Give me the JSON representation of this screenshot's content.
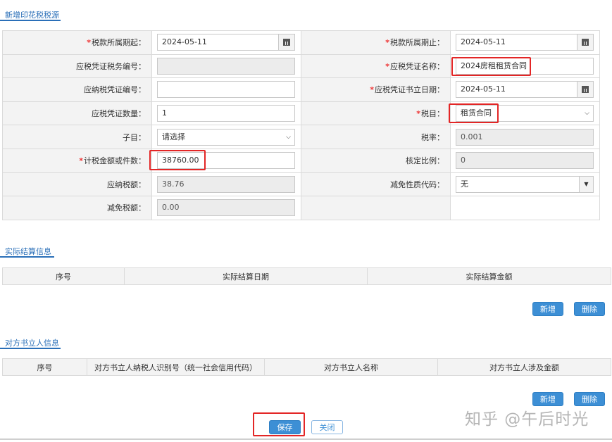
{
  "section1": {
    "title": "新增印花税税源"
  },
  "form": {
    "period_start_label": "税款所属期起：",
    "period_start_value": "2024-05-11",
    "period_end_label": "税款所属期止：",
    "period_end_value": "2024-05-11",
    "voucher_tax_no_label": "应税凭证税务编号：",
    "voucher_tax_no_value": "",
    "voucher_name_label": "应税凭证名称：",
    "voucher_name_value": "2024房租租赁合同",
    "voucher_no_label": "应纳税凭证编号：",
    "voucher_no_value": "",
    "voucher_date_label": "应税凭证书立日期：",
    "voucher_date_value": "2024-05-11",
    "voucher_count_label": "应税凭证数量：",
    "voucher_count_value": "1",
    "tax_item_label": "税目：",
    "tax_item_value": "租赁合同",
    "sub_item_label": "子目：",
    "sub_item_value": "请选择",
    "tax_rate_label": "税率：",
    "tax_rate_value": "0.001",
    "taxable_amount_label": "计税金额或件数：",
    "taxable_amount_value": "38760.00",
    "approved_ratio_label": "核定比例：",
    "approved_ratio_value": "0",
    "tax_payable_label": "应纳税额：",
    "tax_payable_value": "38.76",
    "exemption_code_label": "减免性质代码：",
    "exemption_code_value": "无",
    "tax_exempt_label": "减免税额：",
    "tax_exempt_value": "0.00"
  },
  "section2": {
    "title": "实际结算信息",
    "columns": [
      "序号",
      "实际结算日期",
      "实际结算金额"
    ],
    "add_label": "新增",
    "delete_label": "删除"
  },
  "section3": {
    "title": "对方书立人信息",
    "columns": [
      "序号",
      "对方书立人纳税人识别号（统一社会信用代码）",
      "对方书立人名称",
      "对方书立人涉及金额"
    ],
    "add_label": "新增",
    "delete_label": "删除"
  },
  "footer": {
    "save_label": "保存",
    "close_label": "关闭"
  },
  "watermark": "知乎 @午后时光",
  "colors": {
    "accent": "#2a6fb8",
    "button": "#3d8fd5",
    "highlight": "#e32626",
    "required": "#e33333"
  }
}
